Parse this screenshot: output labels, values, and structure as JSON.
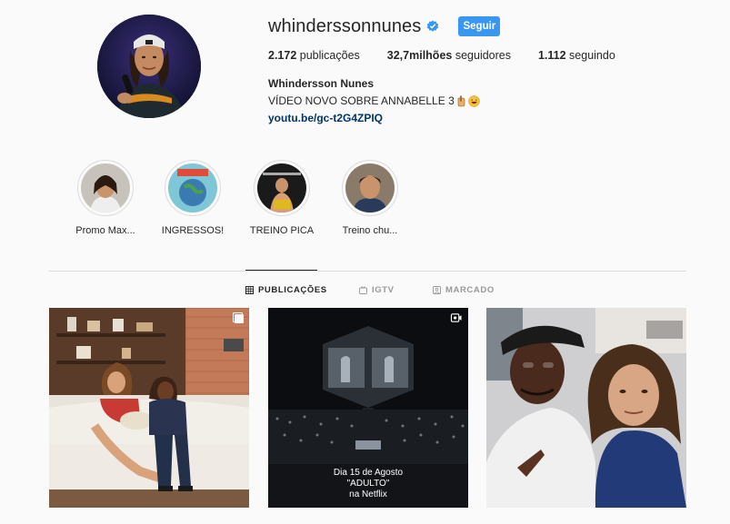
{
  "profile": {
    "username": "whinderssonnunes",
    "verified": true,
    "follow_label": "Seguir",
    "full_name": "Whindersson Nunes",
    "bio": "VÍDEO NOVO SOBRE ANNABELLE 3",
    "link": "youtu.be/gc-t2G4ZPIQ",
    "accent_color": "#3897f0"
  },
  "stats": {
    "posts_count": "2.172",
    "posts_label": " publicações",
    "followers_count": "32,7milhões",
    "followers_label": " seguidores",
    "following_count": "1.112",
    "following_label": " seguindo"
  },
  "highlights": [
    {
      "label": "Promo Max..."
    },
    {
      "label": "INGRESSOS!"
    },
    {
      "label": "TREINO PICA"
    },
    {
      "label": "Treino chu..."
    }
  ],
  "tabs": [
    {
      "label": "PUBLICAÇÕES",
      "icon": "grid-icon",
      "active": true
    },
    {
      "label": "IGTV",
      "icon": "igtv-icon",
      "active": false
    },
    {
      "label": "MARCADO",
      "icon": "tagged-icon",
      "active": false
    }
  ],
  "posts": [
    {
      "type": "carousel",
      "icon": "carousel-icon"
    },
    {
      "type": "igtv",
      "icon": "igtv-video-icon",
      "overlay_line1": "Dia 15 de Agosto",
      "overlay_line2": "\"ADULTO\"",
      "overlay_line3": "na Netflix"
    },
    {
      "type": "photo"
    }
  ]
}
